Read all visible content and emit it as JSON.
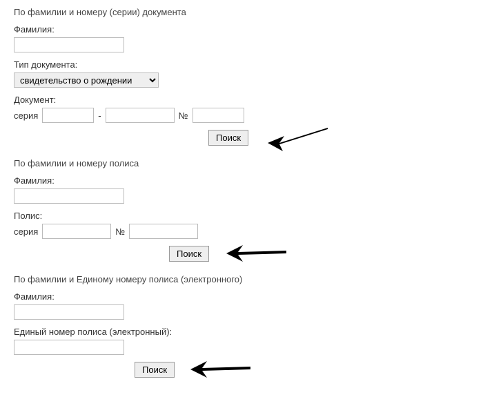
{
  "sections": {
    "byDocument": {
      "title": "По фамилии и номеру (серии) документа",
      "surnameLabel": "Фамилия:",
      "docTypeLabel": "Тип документа:",
      "docTypeSelected": "свидетельство о рождении",
      "documentLabel": "Документ:",
      "seriesLabel": "серия",
      "numberSymbol": "№",
      "dash": "-",
      "searchLabel": "Поиск"
    },
    "byPolicy": {
      "title": "По фамилии и номеру полиса",
      "surnameLabel": "Фамилия:",
      "policyLabel": "Полис:",
      "seriesLabel": "серия",
      "numberSymbol": "№",
      "searchLabel": "Поиск"
    },
    "byUnified": {
      "title": "По фамилии и Единому номеру полиса (электронного)",
      "surnameLabel": "Фамилия:",
      "unifiedLabel": "Единый номер полиса (электронный):",
      "searchLabel": "Поиск"
    }
  }
}
